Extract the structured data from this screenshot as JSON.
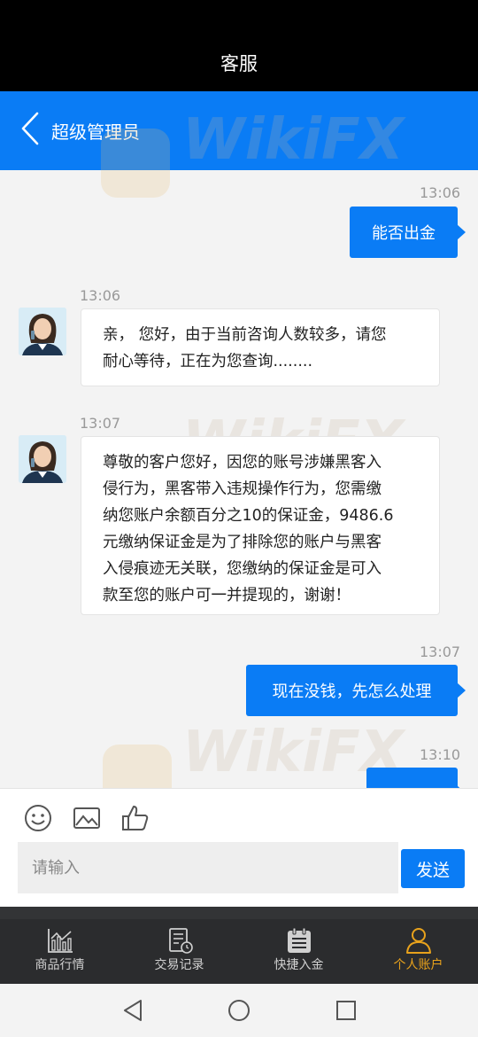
{
  "status_bar": {
    "title": "客服"
  },
  "header": {
    "contact_name": "超级管理员"
  },
  "watermark": {
    "text": "WikiFX"
  },
  "messages": [
    {
      "time": "13:06",
      "direction": "out",
      "text": "能否出金"
    },
    {
      "time": "13:06",
      "direction": "in",
      "lines": [
        "亲， 您好，由于当前咨询人数较多，请您",
        "耐心等待，正在为您查询........"
      ]
    },
    {
      "time": "13:07",
      "direction": "in",
      "lines": [
        "尊敬的客户您好，因您的账号涉嫌黑客入",
        "侵行为，黑客带入违规操作行为，您需缴",
        "纳您账户余额百分之10的保证金，9486.6",
        "元缴纳保证金是为了排除您的账户与黑客",
        "入侵痕迹无关联，您缴纳的保证金是可入",
        "款至您的账户可一并提现的，谢谢！"
      ]
    },
    {
      "time": "13:07",
      "direction": "out",
      "text": "现在没钱，先怎么处理"
    },
    {
      "time": "13:10",
      "direction": "out",
      "text": ""
    }
  ],
  "composer": {
    "placeholder": "请输入",
    "send_label": "发送",
    "icons": [
      "emoji-icon",
      "image-icon",
      "thumbs-up-icon"
    ]
  },
  "tabbar": {
    "items": [
      {
        "label": "商品行情",
        "icon": "market-chart-icon",
        "active": false
      },
      {
        "label": "交易记录",
        "icon": "record-icon",
        "active": false
      },
      {
        "label": "快捷入金",
        "icon": "deposit-icon",
        "active": false
      },
      {
        "label": "个人账户",
        "icon": "person-icon",
        "active": true
      }
    ]
  },
  "colors": {
    "accent": "#0a7cf5",
    "active_tab": "#e8a21c",
    "tabbar_bg": "#2b2c2e"
  }
}
